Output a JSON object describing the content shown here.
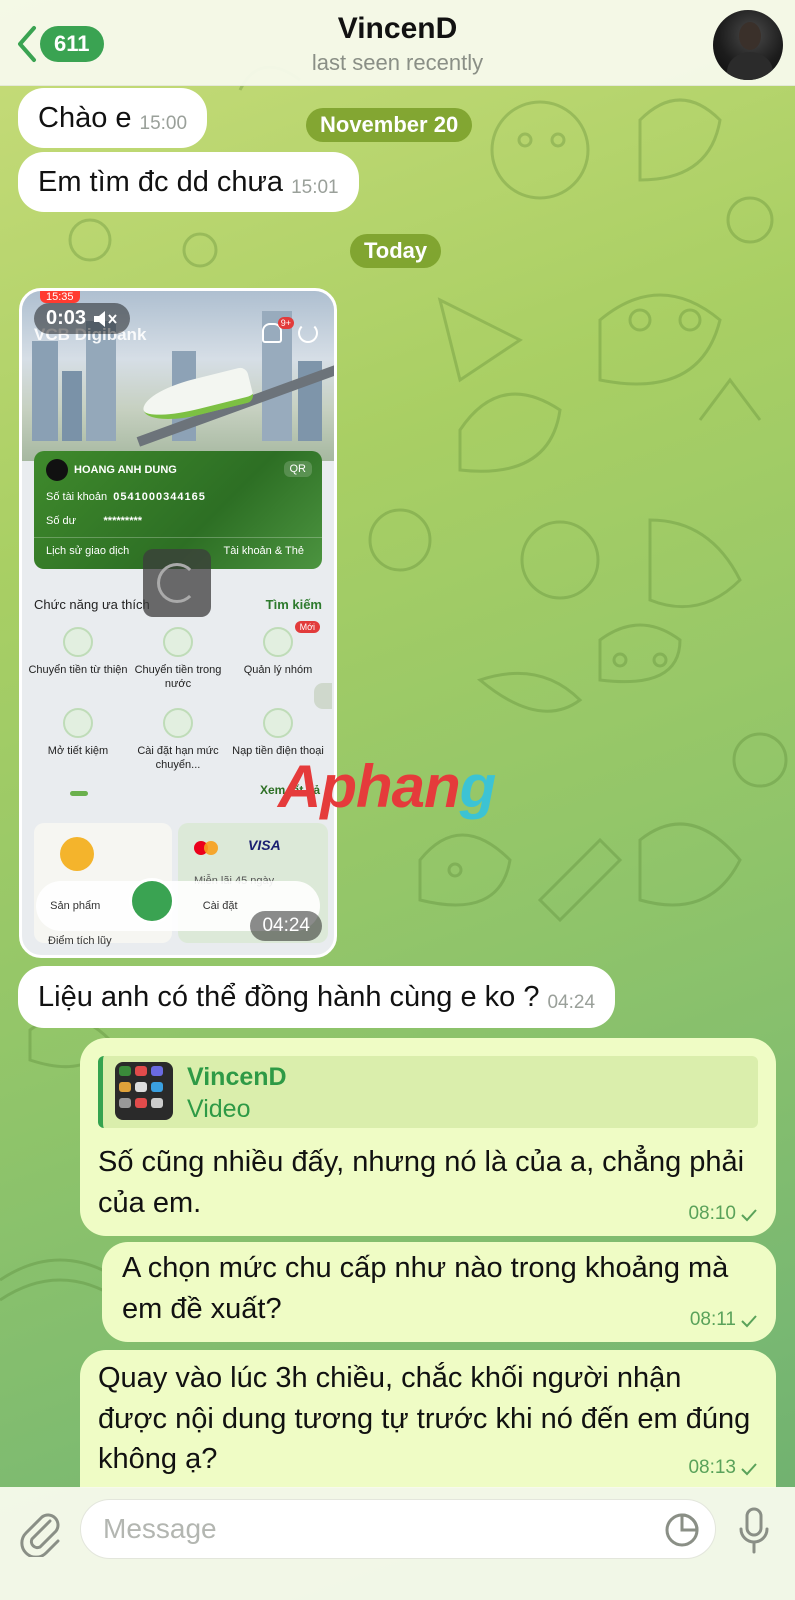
{
  "header": {
    "back_count": "611",
    "title": "VincenD",
    "status": "last seen recently"
  },
  "pills": {
    "date1": "November 20",
    "date2": "Today"
  },
  "messages": [
    {
      "text": "Chào e",
      "time": "15:00"
    },
    {
      "text": "Em tìm đc dd chưa",
      "time": "15:01"
    },
    {
      "text": "Liệu anh có thể đồng hành cùng e ko ?",
      "time": "04:24"
    },
    {
      "text": "Số cũng nhiều đấy, nhưng nó là của a, chẳng phải của em.",
      "time": "08:10"
    },
    {
      "text": "A chọn mức chu cấp như nào trong khoảng mà em đề xuất?",
      "time": "08:11"
    },
    {
      "text": "Quay vào lúc 3h chiều, chắc khối người nhận được nội dung tương tự trước khi nó đến em đúng không ạ?",
      "time": "08:13"
    }
  ],
  "reply": {
    "name": "VincenD",
    "type": "Video"
  },
  "video": {
    "duration": "0:03",
    "time": "04:24",
    "status_time": "15:35",
    "app_logo": "VCB Digibank",
    "badge": "9+",
    "account_name": "HOANG ANH DUNG",
    "qr": "QR",
    "account_label": "Số tài khoản",
    "account_number": "0541000344165",
    "balance_label": "Số dư",
    "balance_masked": "*********",
    "history": "Lịch sử giao dịch",
    "accounts": "Tài khoản & Thẻ",
    "fav_title": "Chức năng ưa thích",
    "search": "Tìm kiếm",
    "new_badge": "Mới",
    "grid": [
      "Chuyển tiền từ thiện",
      "Chuyển tiền trong nước",
      "Quản lý nhóm",
      "Mở tiết kiệm",
      "Cài đặt hạn mức chuyển...",
      "Nạp tiền điện thoại"
    ],
    "see_all": "Xem tất cả",
    "visa": "VISA",
    "promo_text": "Miễn lãi 45 ngày",
    "tab_products": "Sản phẩm",
    "tab_settings": "Cài đặt",
    "promo_left": "Điểm tích lũy"
  },
  "watermark": {
    "part1": "Aphan",
    "part2": "g"
  },
  "input": {
    "placeholder": "Message"
  },
  "colors": {
    "accent": "#3aa352",
    "incoming": "#ffffff",
    "outgoing": "#effcc5",
    "pill": "#70961e"
  }
}
